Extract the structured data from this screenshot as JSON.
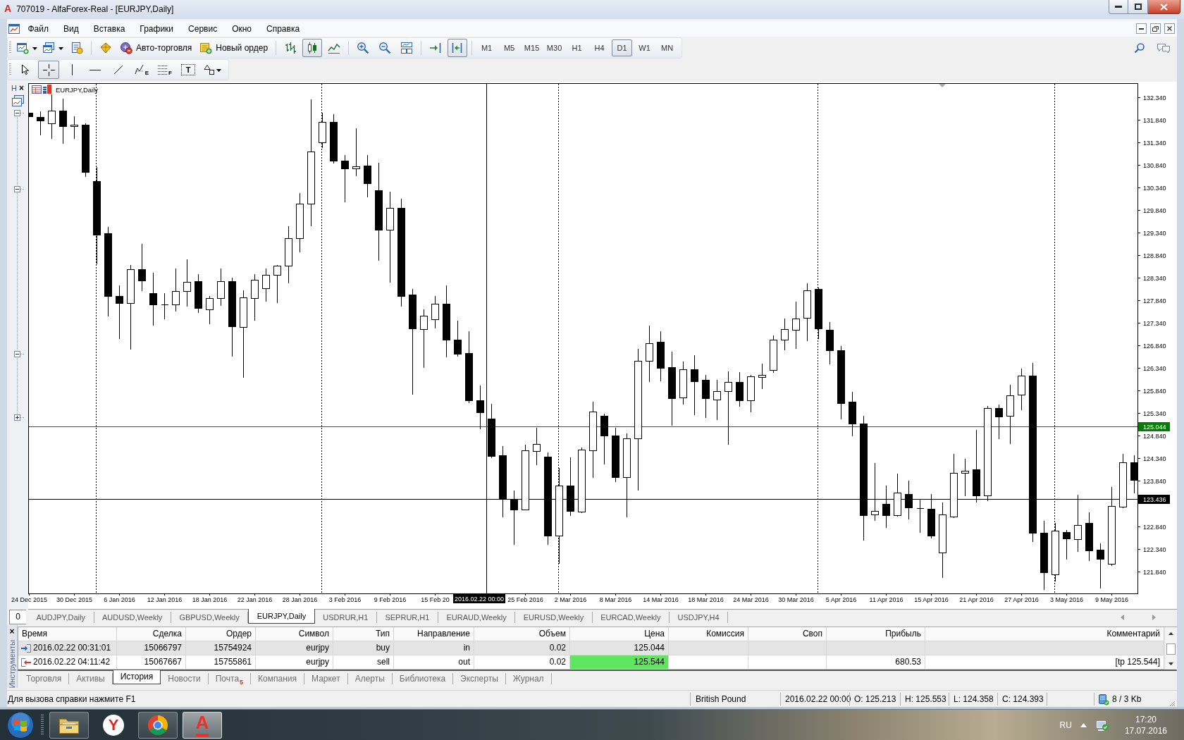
{
  "window": {
    "logo": "A",
    "title": "707019 - AlfaForex-Real - [EURJPY,Daily]"
  },
  "menu": [
    "Файл",
    "Вид",
    "Вставка",
    "Графики",
    "Сервис",
    "Окно",
    "Справка"
  ],
  "toolbar": {
    "auto_trading": "Авто-торговля",
    "new_order": "Новый ордер",
    "chart_types": [
      {
        "kind": "bars",
        "selected": false
      },
      {
        "kind": "candles",
        "selected": true
      },
      {
        "kind": "line",
        "selected": false
      }
    ],
    "chart_modes": [
      {
        "kind": "autoscroll",
        "selected": false
      },
      {
        "kind": "shift",
        "selected": true
      }
    ],
    "timeframes": [
      {
        "label": "M1",
        "selected": false
      },
      {
        "label": "M5",
        "selected": false
      },
      {
        "label": "M15",
        "selected": false
      },
      {
        "label": "M30",
        "selected": false
      },
      {
        "label": "H1",
        "selected": false
      },
      {
        "label": "H4",
        "selected": false
      },
      {
        "label": "D1",
        "selected": true
      },
      {
        "label": "W1",
        "selected": false
      },
      {
        "label": "MN",
        "selected": false
      }
    ]
  },
  "drawing_tools": [
    {
      "kind": "cursor",
      "selected": false
    },
    {
      "kind": "crosshair",
      "selected": true
    },
    {
      "kind": "vline",
      "selected": false
    },
    {
      "kind": "hline",
      "selected": false
    },
    {
      "kind": "trendline",
      "selected": false
    },
    {
      "kind": "channel",
      "glyph": "E",
      "selected": false
    },
    {
      "kind": "fibo",
      "glyph": "F",
      "selected": false
    },
    {
      "kind": "text",
      "glyph": "T",
      "selected": false
    },
    {
      "kind": "shapes",
      "selected": false
    }
  ],
  "left_panel": {
    "title": "H",
    "close": "×",
    "footer": "0"
  },
  "chart": {
    "chart_data": [
      {
        "type": "candlestick",
        "title": "EURJPY,Daily",
        "grid": true,
        "categories": [
          "24 Dec 2015",
          null,
          null,
          null,
          "30 Dec 2015",
          null,
          null,
          null,
          "6 Jan 2016",
          null,
          null,
          null,
          "12 Jan 2016",
          null,
          null,
          null,
          "18 Jan 2016",
          null,
          null,
          null,
          "22 Jan 2016",
          null,
          null,
          null,
          "28 Jan 2016",
          null,
          null,
          null,
          "3 Feb 2016",
          null,
          null,
          null,
          "9 Feb 2016",
          null,
          null,
          null,
          "15 Feb 20",
          null,
          null,
          null,
          null,
          null,
          null,
          null,
          "25 Feb 2016",
          null,
          null,
          null,
          "2 Mar 2016",
          null,
          null,
          null,
          "8 Mar 2016",
          null,
          null,
          null,
          "14 Mar 2016",
          null,
          null,
          null,
          "18 Mar 2016",
          null,
          null,
          null,
          "24 Mar 2016",
          null,
          null,
          null,
          "30 Mar 2016",
          null,
          null,
          null,
          "5 Apr 2016",
          null,
          null,
          null,
          "11 Apr 2016",
          null,
          null,
          null,
          "15 Apr 2016",
          null,
          null,
          null,
          "21 Apr 2016",
          null,
          null,
          null,
          "27 Apr 2016",
          null,
          null,
          null,
          "3 May 2016",
          null,
          null,
          null,
          "9 May 2016",
          null,
          null
        ],
        "ohlc": [
          [
            131.986,
            131.99,
            131.91,
            131.913
          ],
          [
            131.905,
            132.016,
            131.515,
            131.817
          ],
          [
            131.765,
            132.399,
            131.426,
            132.045
          ],
          [
            132.045,
            132.311,
            131.316,
            131.692
          ],
          [
            131.692,
            131.92,
            131.426,
            131.728
          ],
          [
            131.728,
            131.758,
            130.594,
            130.675
          ],
          [
            130.476,
            130.793,
            128.655,
            129.297
          ],
          [
            129.319,
            129.466,
            127.491,
            127.933
          ],
          [
            127.941,
            128.162,
            126.997,
            127.786
          ],
          [
            127.786,
            128.619,
            126.769,
            128.53
          ],
          [
            128.53,
            129.083,
            128.059,
            128.28
          ],
          [
            127.992,
            128.456,
            127.292,
            127.749
          ],
          [
            127.749,
            127.992,
            127.432,
            127.749
          ],
          [
            127.749,
            128.538,
            127.609,
            128.051
          ],
          [
            128.051,
            128.744,
            127.712,
            128.243
          ],
          [
            128.258,
            128.42,
            127.58,
            127.675
          ],
          [
            127.646,
            127.933,
            127.329,
            127.882
          ],
          [
            127.882,
            128.538,
            127.734,
            128.258
          ],
          [
            128.258,
            128.346,
            126.607,
            127.27
          ],
          [
            127.255,
            128.066,
            126.143,
            127.904
          ],
          [
            127.896,
            128.42,
            127.403,
            128.287
          ],
          [
            128.103,
            128.538,
            127.83,
            128.398
          ],
          [
            128.398,
            128.626,
            127.793,
            128.604
          ],
          [
            128.604,
            129.473,
            128.235,
            129.208
          ],
          [
            129.208,
            130.21,
            128.921,
            129.982
          ],
          [
            129.982,
            132.288,
            129.503,
            131.139
          ],
          [
            131.33,
            131.994,
            131.22,
            131.795
          ],
          [
            131.795,
            131.957,
            130.881,
            130.925
          ],
          [
            130.925,
            131.05,
            130.019,
            130.756
          ],
          [
            130.756,
            131.647,
            130.608,
            130.807
          ],
          [
            130.815,
            131.05,
            130.137,
            130.439
          ],
          [
            130.277,
            130.888,
            128.737,
            129.407
          ],
          [
            129.407,
            130.24,
            128.25,
            129.893
          ],
          [
            129.893,
            130.092,
            127.72,
            127.941
          ],
          [
            127.963,
            128.088,
            125.767,
            127.219
          ],
          [
            127.204,
            127.646,
            126.356,
            127.506
          ],
          [
            127.425,
            127.941,
            127.233,
            127.771
          ],
          [
            127.771,
            128.169,
            126.592,
            126.961
          ],
          [
            126.975,
            127.388,
            126.607,
            126.651
          ],
          [
            126.666,
            127.152,
            125.583,
            125.619
          ],
          [
            125.634,
            125.951,
            125.008,
            125.362
          ],
          [
            125.213,
            125.553,
            124.358,
            124.393
          ],
          [
            124.403,
            124.61,
            123.055,
            123.445
          ],
          [
            123.445,
            123.63,
            122.451,
            123.202
          ],
          [
            123.21,
            124.639,
            123.2,
            124.514
          ],
          [
            124.507,
            125.015,
            124.205,
            124.654
          ],
          [
            124.381,
            124.477,
            122.451,
            122.635
          ],
          [
            122.635,
            124.123,
            122.023,
            123.733
          ],
          [
            123.733,
            124.359,
            123.077,
            123.173
          ],
          [
            123.158,
            124.588,
            123.143,
            124.529
          ],
          [
            124.521,
            125.597,
            123.924,
            125.369
          ],
          [
            125.28,
            125.325,
            124.219,
            124.846
          ],
          [
            124.853,
            125.015,
            123.836,
            123.924
          ],
          [
            123.924,
            124.897,
            123.055,
            124.787
          ],
          [
            124.787,
            126.762,
            123.645,
            126.504
          ],
          [
            126.504,
            127.277,
            126.047,
            126.894
          ],
          [
            126.916,
            127.152,
            126.069,
            126.342
          ],
          [
            126.356,
            126.703,
            125.081,
            125.671
          ],
          [
            125.693,
            126.482,
            125.546,
            126.305
          ],
          [
            126.305,
            126.622,
            125.317,
            126.047
          ],
          [
            126.076,
            126.187,
            125.251,
            125.671
          ],
          [
            125.642,
            126.076,
            125.199,
            125.833
          ],
          [
            125.833,
            126.26,
            124.661,
            126.039
          ],
          [
            126.025,
            126.246,
            125.494,
            125.627
          ],
          [
            125.627,
            126.187,
            125.376,
            126.15
          ],
          [
            126.143,
            126.445,
            125.899,
            126.187
          ],
          [
            126.297,
            127.056,
            126.253,
            126.975
          ],
          [
            126.961,
            127.44,
            126.754,
            127.196
          ],
          [
            127.182,
            127.808,
            126.776,
            127.44
          ],
          [
            127.454,
            128.213,
            126.946,
            128.066
          ],
          [
            128.088,
            128.125,
            126.997,
            127.219
          ],
          [
            127.182,
            127.351,
            126.43,
            126.74
          ],
          [
            126.74,
            126.828,
            125.221,
            125.568
          ],
          [
            125.597,
            125.818,
            124.846,
            125.118
          ],
          [
            125.118,
            125.288,
            122.539,
            123.085
          ],
          [
            123.099,
            124.234,
            122.967,
            123.173
          ],
          [
            123.335,
            123.733,
            122.819,
            123.085
          ],
          [
            123.085,
            123.998,
            123.07,
            123.586
          ],
          [
            123.556,
            123.851,
            123.011,
            123.261
          ],
          [
            123.246,
            123.423,
            122.709,
            123.246
          ],
          [
            123.225,
            123.556,
            122.583,
            122.628
          ],
          [
            122.259,
            123.357,
            121.714,
            123.099
          ],
          [
            123.055,
            124.433,
            123.04,
            124.02
          ],
          [
            124.02,
            124.33,
            123.519,
            124.072
          ],
          [
            124.094,
            124.971,
            123.372,
            123.519
          ],
          [
            123.519,
            125.494,
            123.409,
            125.457
          ],
          [
            125.457,
            125.531,
            124.787,
            125.273
          ],
          [
            125.288,
            125.966,
            124.676,
            125.73
          ],
          [
            125.745,
            126.334,
            125.42,
            126.179
          ],
          [
            126.165,
            126.459,
            122.502,
            122.694
          ],
          [
            122.687,
            122.952,
            121.441,
            121.824
          ],
          [
            121.773,
            122.915,
            121.625,
            122.745
          ],
          [
            122.716,
            122.76,
            122.119,
            122.568
          ],
          [
            122.554,
            123.534,
            122.289,
            122.871
          ],
          [
            122.915,
            123.143,
            122.082,
            122.303
          ],
          [
            122.325,
            122.465,
            121.478,
            122.119
          ],
          [
            122.009,
            123.703,
            121.972,
            123.291
          ],
          [
            123.276,
            124.44,
            123.261,
            124.249
          ],
          [
            124.249,
            124.403,
            123.578,
            123.866
          ]
        ],
        "ylim": [
          121.351,
          132.632
        ],
        "yticks": [
          {
            "value": 132.34,
            "label": "132.340"
          },
          {
            "value": 131.84,
            "label": "131.840"
          },
          {
            "value": 131.34,
            "label": "131.340"
          },
          {
            "value": 130.84,
            "label": "130.840"
          },
          {
            "value": 130.34,
            "label": "130.340"
          },
          {
            "value": 129.84,
            "label": "129.840"
          },
          {
            "value": 129.34,
            "label": "129.340"
          },
          {
            "value": 128.84,
            "label": "128.840"
          },
          {
            "value": 128.34,
            "label": "128.340"
          },
          {
            "value": 127.84,
            "label": "127.840"
          },
          {
            "value": 127.34,
            "label": "127.340"
          },
          {
            "value": 126.84,
            "label": "126.840"
          },
          {
            "value": 126.34,
            "label": "126.340"
          },
          {
            "value": 125.84,
            "label": "125.840"
          },
          {
            "value": 125.34,
            "label": "125.340"
          },
          {
            "value": 124.84,
            "label": "124.840"
          },
          {
            "value": 124.34,
            "label": "124.340"
          },
          {
            "value": 123.84,
            "label": "123.840"
          },
          {
            "value": 122.84,
            "label": "122.840"
          },
          {
            "value": 122.34,
            "label": "122.340"
          },
          {
            "value": 121.84,
            "label": "121.840"
          }
        ],
        "ref_lines": [
          {
            "axis": "y",
            "value": 125.044,
            "label": "125.044",
            "color": "#008000"
          },
          {
            "axis": "y",
            "value": 123.436,
            "label": "123.436",
            "color": "#000000"
          }
        ],
        "annotations": [
          "2016.02.22 00:00"
        ]
      }
    ]
  },
  "chart_tabs": [
    {
      "label": "AUDJPY,Daily",
      "selected": false
    },
    {
      "label": "AUDUSD,Weekly",
      "selected": false
    },
    {
      "label": "GBPUSD,Weekly",
      "selected": false
    },
    {
      "label": "EURJPY,Daily",
      "selected": true
    },
    {
      "label": "USDRUR,H1",
      "selected": false
    },
    {
      "label": "SEPRUR,H1",
      "selected": false
    },
    {
      "label": "EURAUD,Weekly",
      "selected": false
    },
    {
      "label": "EURUSD,Weekly",
      "selected": false
    },
    {
      "label": "EURCAD,Weekly",
      "selected": false
    },
    {
      "label": "USDJPY,H4",
      "selected": false
    }
  ],
  "terminal": {
    "close": "×",
    "panel_title": "Инструменты",
    "columns": [
      "Время",
      "Сделка",
      "Ордер",
      "Символ",
      "Тип",
      "Направление",
      "Объем",
      "Цена",
      "Комиссия",
      "Своп",
      "Прибыль",
      "Комментарий"
    ],
    "rows": [
      {
        "kind": "in",
        "selected": true,
        "time": "2016.02.22 00:31:01",
        "deal": "15066797",
        "order": "15754924",
        "symbol": "eurjpy",
        "type": "buy",
        "direction": "in",
        "volume": "0.02",
        "price": "125.044",
        "price_highlighted": false
      },
      {
        "kind": "out",
        "selected": false,
        "time": "2016.02.22 04:11:42",
        "deal": "15067667",
        "order": "15755861",
        "symbol": "eurjpy",
        "type": "sell",
        "direction": "out",
        "volume": "0.02",
        "price": "125.544",
        "price_highlighted": true,
        "profit": "680.53",
        "comment": "[tp 125.544]"
      }
    ],
    "tabs": [
      {
        "label": "Торговля",
        "selected": false
      },
      {
        "label": "Активы",
        "selected": false
      },
      {
        "label": "История",
        "selected": true
      },
      {
        "label": "Новости",
        "selected": false
      },
      {
        "label": "Почта",
        "badge": "5",
        "selected": false
      },
      {
        "label": "Компания",
        "selected": false
      },
      {
        "label": "Маркет",
        "selected": false
      },
      {
        "label": "Алерты",
        "selected": false
      },
      {
        "label": "Библиотека",
        "selected": false
      },
      {
        "label": "Эксперты",
        "selected": false
      },
      {
        "label": "Журнал",
        "selected": false
      }
    ]
  },
  "status_bar": {
    "help": "Для вызова справки нажмите F1",
    "symbol_name": "British Pound",
    "time": "2016.02.22 00:00",
    "open": "O: 125.213",
    "high": "H: 125.553",
    "low": "L: 124.358",
    "close": "C: 124.393",
    "traffic": "8 / 3 Kb"
  },
  "taskbar": {
    "apps": [
      {
        "kind": "folder",
        "running": true,
        "selected": false
      },
      {
        "kind": "circle_glyph",
        "glyph": "Y",
        "running": false,
        "selected": false
      },
      {
        "kind": "ring",
        "running": true,
        "selected": false
      },
      {
        "kind": "glyph",
        "glyph": "A",
        "running": true,
        "selected": true
      }
    ],
    "language": "RU",
    "time": "17:20",
    "date": "17.07.2016"
  }
}
